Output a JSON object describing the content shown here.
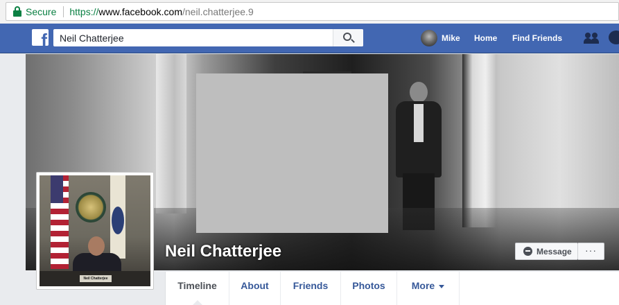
{
  "browser": {
    "secure_label": "Secure",
    "url_scheme": "https://",
    "url_host": "www.facebook.com",
    "url_path": "/neil.chatterjee.9"
  },
  "topbar": {
    "logo_letter": "f",
    "search_value": "Neil Chatterjee",
    "user_name": "Mike",
    "home_label": "Home",
    "find_friends_label": "Find Friends",
    "brand_color": "#4267b2"
  },
  "profile": {
    "name": "Neil Chatterjee",
    "nameplate": "Neil Chatterjee",
    "message_label": "Message",
    "more_label": "···"
  },
  "tabs": [
    {
      "label": "Timeline",
      "active": true
    },
    {
      "label": "About"
    },
    {
      "label": "Friends"
    },
    {
      "label": "Photos"
    },
    {
      "label": "More"
    }
  ]
}
